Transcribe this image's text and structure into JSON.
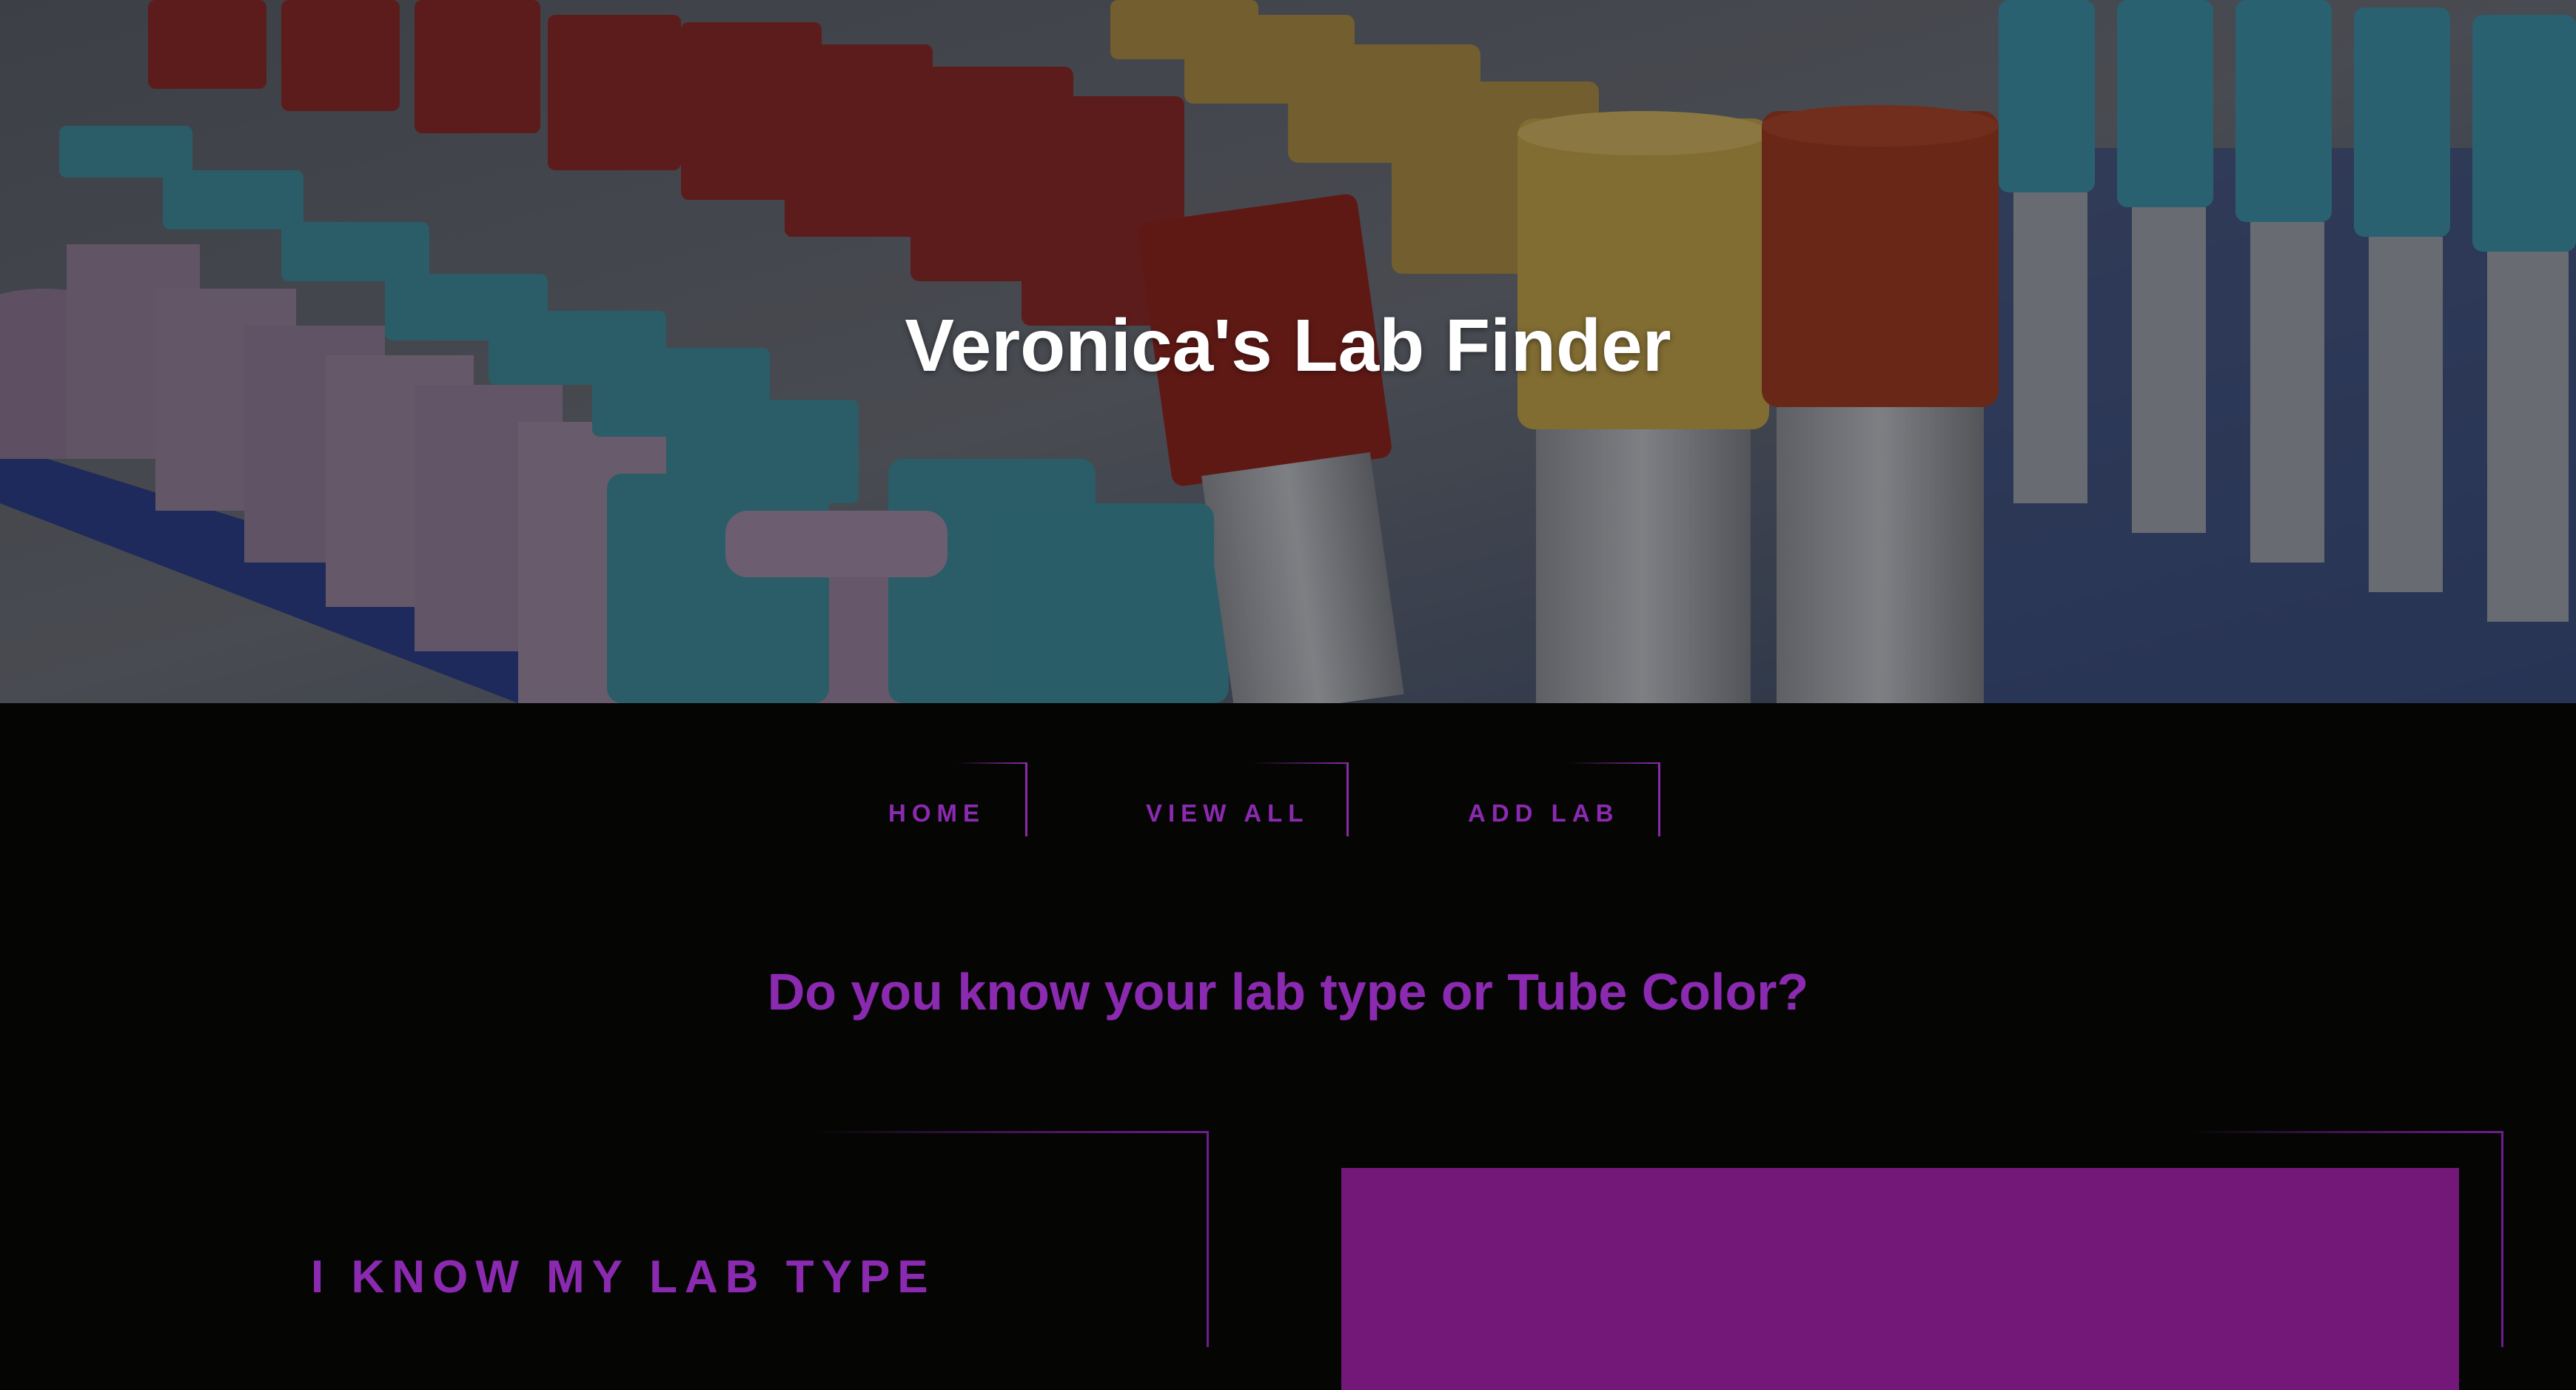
{
  "hero": {
    "title": "Veronica's Lab Finder"
  },
  "nav": {
    "items": [
      {
        "label": "HOME"
      },
      {
        "label": "VIEW ALL"
      },
      {
        "label": "ADD LAB"
      }
    ]
  },
  "main": {
    "question": "Do you know your lab type or Tube Color?",
    "options": [
      {
        "label": "I KNOW MY LAB TYPE"
      }
    ]
  },
  "colors": {
    "accent": "#8b2ab1",
    "panel": "#731879",
    "background": "#050604"
  }
}
